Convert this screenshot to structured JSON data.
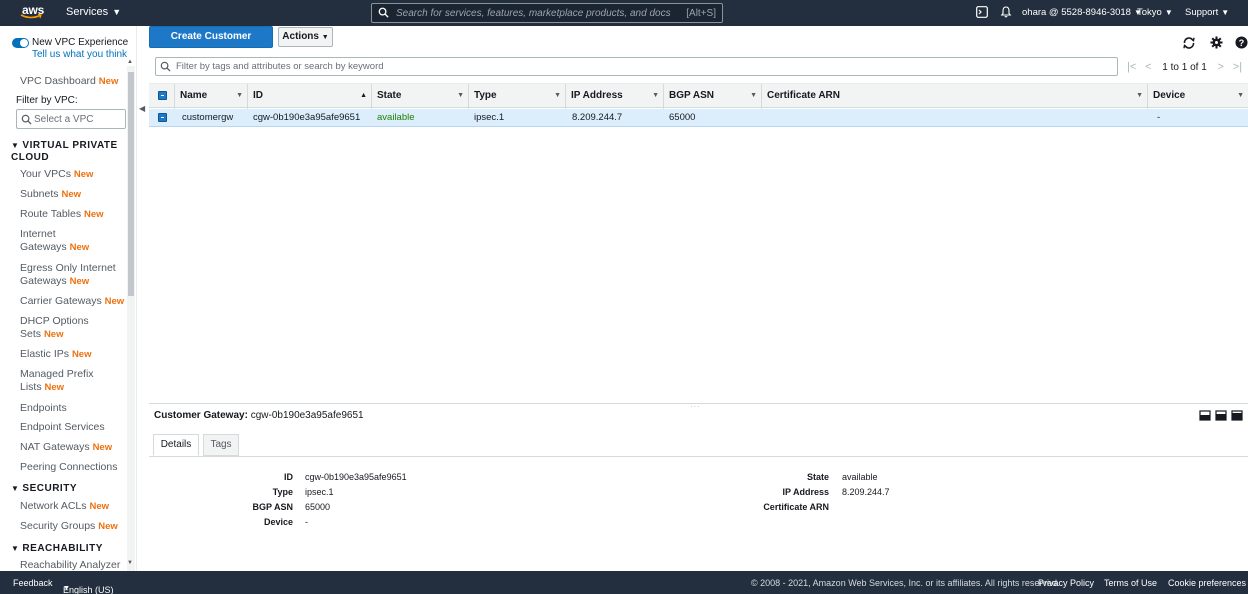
{
  "topnav": {
    "logo": "aws",
    "services_label": "Services",
    "search_placeholder": "Search for services, features, marketplace products, and docs",
    "search_hotkey": "[Alt+S]",
    "account": "ohara @ 5528-8946-3018",
    "region": "Tokyo",
    "support": "Support"
  },
  "sidebar": {
    "new_experience": "New VPC Experience",
    "feedback": "Tell us what you think",
    "new_badge": "New",
    "dashboard": "VPC Dashboard",
    "filter_label": "Filter by VPC:",
    "filter_placeholder": "Select a VPC",
    "sections": {
      "vpc": "VIRTUAL PRIVATE CLOUD",
      "security": "SECURITY",
      "reachability": "REACHABILITY"
    },
    "items": [
      {
        "label": "Your VPCs",
        "new": true
      },
      {
        "label": "Subnets",
        "new": true
      },
      {
        "label": "Route Tables",
        "new": true
      },
      {
        "label": "Internet Gateways",
        "new": true
      },
      {
        "label": "Egress Only Internet Gateways",
        "new": true
      },
      {
        "label": "Carrier Gateways",
        "new": true
      },
      {
        "label": "DHCP Options Sets",
        "new": true
      },
      {
        "label": "Elastic IPs",
        "new": true
      },
      {
        "label": "Managed Prefix Lists",
        "new": true
      },
      {
        "label": "Endpoints",
        "new": false
      },
      {
        "label": "Endpoint Services",
        "new": false
      },
      {
        "label": "NAT Gateways",
        "new": true
      },
      {
        "label": "Peering Connections",
        "new": false
      }
    ],
    "security_items": [
      {
        "label": "Network ACLs",
        "new": true
      },
      {
        "label": "Security Groups",
        "new": true
      }
    ],
    "reachability_items": [
      {
        "label": "Reachability Analyzer",
        "new": false
      }
    ]
  },
  "toolbar": {
    "create_label": "Create Customer Gateway",
    "actions_label": "Actions"
  },
  "filter": {
    "placeholder": "Filter by tags and attributes or search by keyword"
  },
  "pager": {
    "count": "1 to 1 of 1"
  },
  "table": {
    "columns": [
      "Name",
      "ID",
      "State",
      "Type",
      "IP Address",
      "BGP ASN",
      "Certificate ARN",
      "Device"
    ],
    "rows": [
      {
        "name": "customergw",
        "id": "cgw-0b190e3a95afe9651",
        "state": "available",
        "type": "ipsec.1",
        "ip": "8.209.244.7",
        "bgp": "65000",
        "cert": "",
        "device": "-"
      }
    ]
  },
  "details": {
    "title_label": "Customer Gateway:",
    "title_value": "cgw-0b190e3a95afe9651",
    "tabs": [
      "Details",
      "Tags"
    ],
    "left": [
      {
        "label": "ID",
        "value": "cgw-0b190e3a95afe9651"
      },
      {
        "label": "Type",
        "value": "ipsec.1"
      },
      {
        "label": "BGP ASN",
        "value": "65000"
      },
      {
        "label": "Device",
        "value": "-"
      }
    ],
    "right": [
      {
        "label": "State",
        "value": "available"
      },
      {
        "label": "IP Address",
        "value": "8.209.244.7"
      },
      {
        "label": "Certificate ARN",
        "value": ""
      }
    ]
  },
  "footer": {
    "feedback": "Feedback",
    "language": "English (US)",
    "copyright": "© 2008 - 2021, Amazon Web Services, Inc. or its affiliates. All rights reserved.",
    "privacy": "Privacy Policy",
    "terms": "Terms of Use",
    "cookies": "Cookie preferences"
  },
  "colors": {
    "nav_bg": "#232f3e",
    "primary": "#1e78c8",
    "available": "#1d8102",
    "new_badge": "#ec7211",
    "link": "#0073bb"
  }
}
